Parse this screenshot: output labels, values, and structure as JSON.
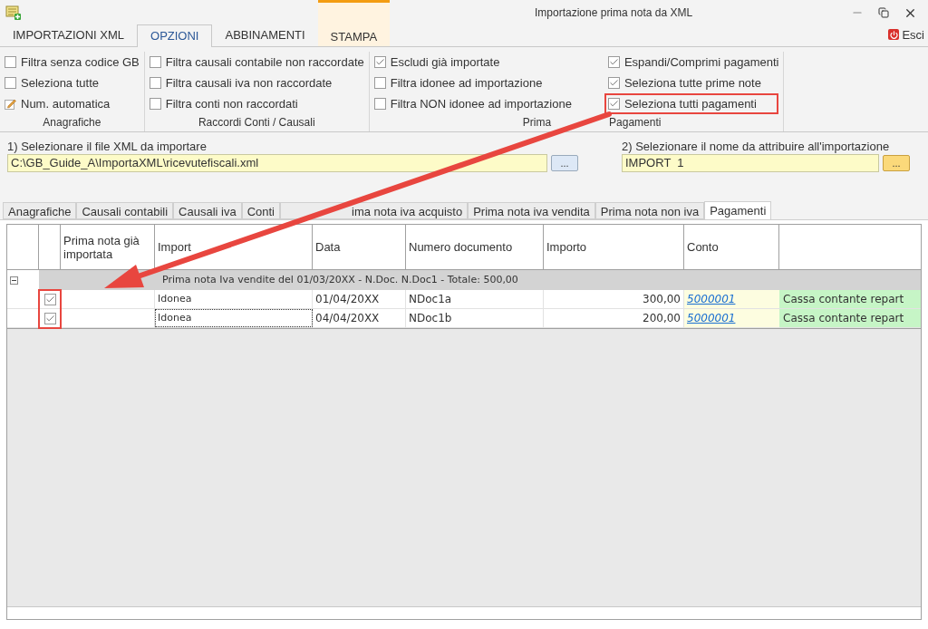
{
  "window": {
    "title": "Importazione prima nota da XML",
    "exit_label": "Esci"
  },
  "ribbon_tabs": [
    {
      "label": "IMPORTAZIONI XML",
      "selected": false,
      "contextual": false
    },
    {
      "label": "OPZIONI",
      "selected": true,
      "contextual": false
    },
    {
      "label": "ABBINAMENTI",
      "selected": false,
      "contextual": false
    },
    {
      "label": "STAMPA",
      "selected": false,
      "contextual": true
    }
  ],
  "option_groups": [
    {
      "label": "Anagrafiche",
      "columns": [
        [
          {
            "kind": "checkbox",
            "label": "Filtra senza codice GB",
            "checked": false
          },
          {
            "kind": "checkbox",
            "label": "Seleziona tutte",
            "checked": false
          },
          {
            "kind": "command",
            "label": "Num. automatica"
          }
        ]
      ]
    },
    {
      "label": "Raccordi Conti / Causali",
      "columns": [
        [
          {
            "kind": "checkbox",
            "label": "Filtra causali contabile non raccordate",
            "checked": false
          },
          {
            "kind": "checkbox",
            "label": "Filtra causali iva non raccordate",
            "checked": false
          },
          {
            "kind": "checkbox",
            "label": "Filtra conti non raccordati",
            "checked": false
          }
        ]
      ]
    },
    {
      "label_parts": [
        "Prima",
        "Pagamenti"
      ],
      "columns": [
        [
          {
            "kind": "checkbox",
            "label": "Escludi già importate",
            "checked": true
          },
          {
            "kind": "checkbox",
            "label": "Filtra idonee ad importazione",
            "checked": false
          },
          {
            "kind": "checkbox",
            "label": "Filtra NON idonee ad importazione",
            "checked": false
          }
        ],
        [
          {
            "kind": "checkbox",
            "label": "Espandi/Comprimi pagamenti",
            "checked": true
          },
          {
            "kind": "checkbox",
            "label": "Seleziona tutte prime note",
            "checked": true
          },
          {
            "kind": "checkbox",
            "label": "Seleziona tutti pagamenti",
            "checked": true,
            "highlighted": true
          }
        ]
      ]
    }
  ],
  "file_field": {
    "label": "1) Selezionare il file XML da importare",
    "value": "C:\\GB_Guide_A\\ImportaXML\\ricevutefiscali.xml",
    "button": "..."
  },
  "name_field": {
    "label": "2) Selezionare il nome da attribuire all'importazione",
    "value": "IMPORT  1",
    "button": "..."
  },
  "sub_tabs": [
    {
      "label": "Anagrafiche",
      "selected": false
    },
    {
      "label": "Causali contabili",
      "selected": false
    },
    {
      "label": "Causali iva",
      "selected": false
    },
    {
      "label": "Conti",
      "selected": false
    },
    {
      "label": "ima nota iva acquisto",
      "selected": false,
      "under_arrow": true
    },
    {
      "label": "Prima nota iva vendita",
      "selected": false
    },
    {
      "label": "Prima nota non iva",
      "selected": false
    },
    {
      "label": "Pagamenti",
      "selected": true
    }
  ],
  "grid": {
    "columns": [
      "Prima nota già importata",
      "Import",
      "Data",
      "Numero documento",
      "Importo",
      "Conto"
    ],
    "group_row": {
      "text": "Prima nota Iva vendite del 01/03/20XX - N.Doc. N.Doc1 - Totale: 500,00",
      "expanded": true
    },
    "rows": [
      {
        "checked": true,
        "importabile": "Idonea",
        "data": "01/04/20XX",
        "numero": "NDoc1a",
        "importo": "300,00",
        "conto": "5000001",
        "descrizione": "Cassa contante repart"
      },
      {
        "checked": true,
        "importabile": "Idonea",
        "data": "04/04/20XX",
        "numero": "NDoc1b",
        "importo": "200,00",
        "conto": "5000001",
        "descrizione": "Cassa contante repart"
      }
    ]
  }
}
